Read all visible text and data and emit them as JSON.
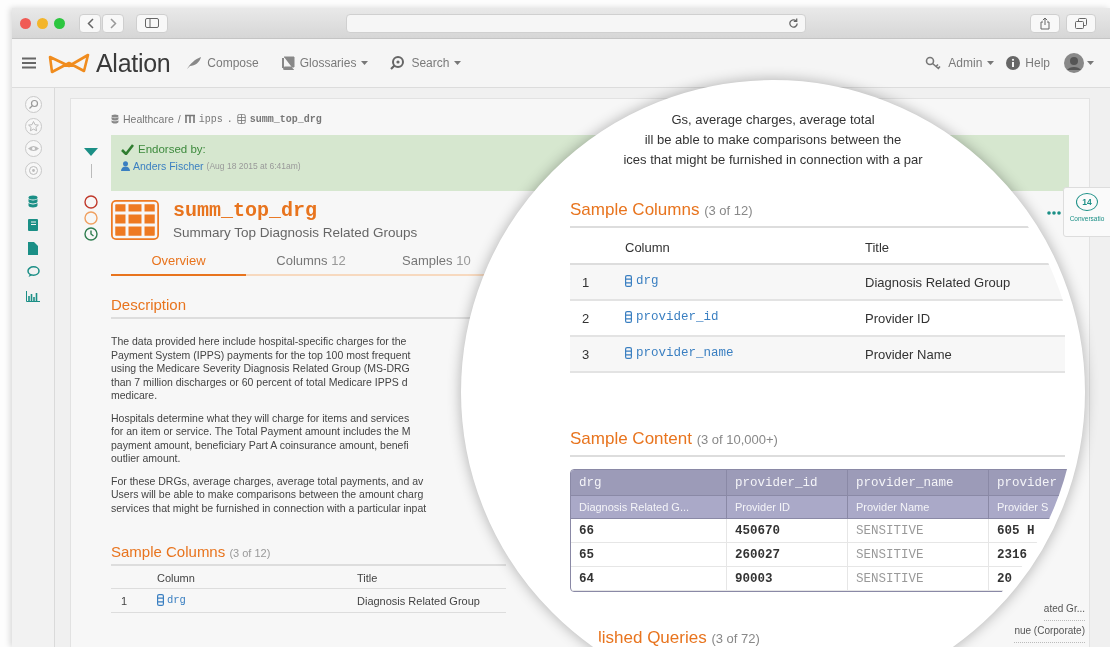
{
  "app_bar": {
    "brand": "Alation",
    "nav": [
      {
        "label": "Compose",
        "kind": "compose",
        "dropdown": false
      },
      {
        "label": "Glossaries",
        "kind": "glossary",
        "dropdown": true
      },
      {
        "label": "Search",
        "kind": "search",
        "dropdown": true
      }
    ],
    "right": [
      {
        "label": "Admin",
        "kind": "admin",
        "dropdown": true
      },
      {
        "label": "Help",
        "kind": "help",
        "dropdown": false
      }
    ]
  },
  "breadcrumb": [
    {
      "label": "Healthcare",
      "kind": "database",
      "separator": "/"
    },
    {
      "label": "ipps",
      "kind": "schema",
      "separator": "."
    },
    {
      "label": "summ_top_drg",
      "kind": "table"
    }
  ],
  "endorsement": {
    "label": "Endorsed by:",
    "user": "Anders Fischer",
    "date": "(Aug 18 2015 at 6:41am)"
  },
  "title": "summ_top_drg",
  "subtitle": "Summary Top Diagnosis Related Groups",
  "tabs": [
    {
      "label": "Overview",
      "selected": true
    },
    {
      "label": "Columns",
      "count": "12",
      "selected": false
    },
    {
      "label": "Samples",
      "count": "10",
      "selected": false
    }
  ],
  "description": {
    "heading": "Description",
    "paragraphs": [
      [
        "The data provided here include hospital-specific charges for the",
        "Payment System (IPPS) payments for the top 100 most frequent",
        "using the Medicare Severity Diagnosis Related Group (MS-DRG",
        "than 7 million discharges or 60 percent of total Medicare IPPS d",
        "medicare."
      ],
      [
        "Hospitals determine what they will charge for items and services",
        "for an item or service. The Total Payment amount includes the M",
        "payment amount, beneficiary Part A coinsurance amount, benefi",
        "outlier amount."
      ],
      [
        "For these DRGs, average charges, average total payments, and av",
        "Users will be able to make comparisons between the amount charg",
        "services that might be furnished in connection with a particular inpat"
      ]
    ]
  },
  "sample_columns": {
    "heading": "Sample Columns",
    "count": "(3 of 12)",
    "columns": [
      "Column",
      "Title"
    ],
    "rows": [
      {
        "index": "1",
        "name": "drg",
        "title": "Diagnosis Related Group"
      }
    ]
  },
  "conversations": {
    "count": "14",
    "label": "Conversatio"
  },
  "right_snippets": [
    "ated Gr...",
    "nue (Corporate)"
  ],
  "magnifier": {
    "text_lines": [
      "Gs, average charges, average total",
      "ill be able to make comparisons between the",
      "ices that might be furnished in connection with a par"
    ],
    "sample_columns": {
      "heading": "Sample Columns",
      "count": "(3 of 12)",
      "columns": [
        "Column",
        "Title"
      ],
      "rows": [
        {
          "index": "1",
          "name": "drg",
          "title": "Diagnosis Related Group"
        },
        {
          "index": "2",
          "name": "provider_id",
          "title": "Provider ID"
        },
        {
          "index": "3",
          "name": "provider_name",
          "title": "Provider Name"
        }
      ]
    },
    "sample_content": {
      "heading": "Sample Content",
      "count": "(3 of 10,000+)",
      "columns": [
        {
          "name": "drg",
          "title": "Diagnosis Related G..."
        },
        {
          "name": "provider_id",
          "title": "Provider ID"
        },
        {
          "name": "provider_name",
          "title": "Provider Name"
        },
        {
          "name": "provider",
          "title": "Provider S"
        }
      ],
      "rows": [
        [
          {
            "text": "66",
            "masked": false
          },
          {
            "text": "450670",
            "masked": false
          },
          {
            "text": "SENSITIVE",
            "masked": true
          },
          {
            "text": "605 H",
            "masked": false
          }
        ],
        [
          {
            "text": "65",
            "masked": false
          },
          {
            "text": "260027",
            "masked": false
          },
          {
            "text": "SENSITIVE",
            "masked": true
          },
          {
            "text": "2316",
            "masked": false
          }
        ],
        [
          {
            "text": "64",
            "masked": false
          },
          {
            "text": "90003",
            "masked": false
          },
          {
            "text": "SENSITIVE",
            "masked": true
          },
          {
            "text": "20",
            "masked": false
          }
        ]
      ]
    },
    "next_section": {
      "heading": "lished Queries",
      "count": "(3 of 72)"
    }
  }
}
